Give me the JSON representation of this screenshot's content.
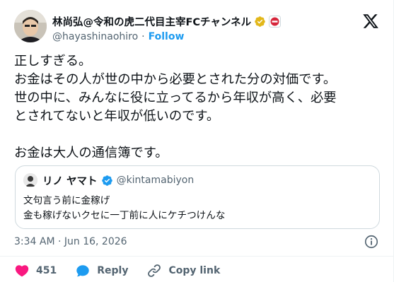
{
  "tweet": {
    "display_name": "林尚弘@令和の虎二代目主宰FCチャンネル",
    "handle": "@hayashinaohiro",
    "separator": "·",
    "follow_label": "Follow",
    "body_lines": [
      "正しすぎる。",
      "お金はその人が世の中から必要とされた分の対価です。",
      "世の中に、みんなに役に立ってるから年収が高く、必要",
      "とされてないと年収が低いのです。",
      "お金は大人の通信簿です。"
    ],
    "timestamp": "3:34 AM · Jun 16, 2026"
  },
  "quoted": {
    "display_name": "リノ ヤマト",
    "handle": "@kintamabiyon",
    "lines": [
      "文句言う前に金稼げ",
      "金も稼げないクセに一丁前に人にケチつけんな"
    ]
  },
  "actions": {
    "like_count": "451",
    "reply_label": "Reply",
    "copy_label": "Copy link"
  },
  "icons": {
    "verified_badge": "gold-verified-icon",
    "affiliate_badge": "affiliate-badge-icon",
    "quoted_verified": "blue-verified-icon",
    "brand": "x-logo-icon",
    "info": "info-icon",
    "like": "heart-icon",
    "reply": "reply-bubble-icon",
    "copy": "link-icon"
  },
  "colors": {
    "accent": "#1d9bf0",
    "like": "#f91880",
    "gold_badge": "#e2b719",
    "text_secondary": "#536471"
  }
}
